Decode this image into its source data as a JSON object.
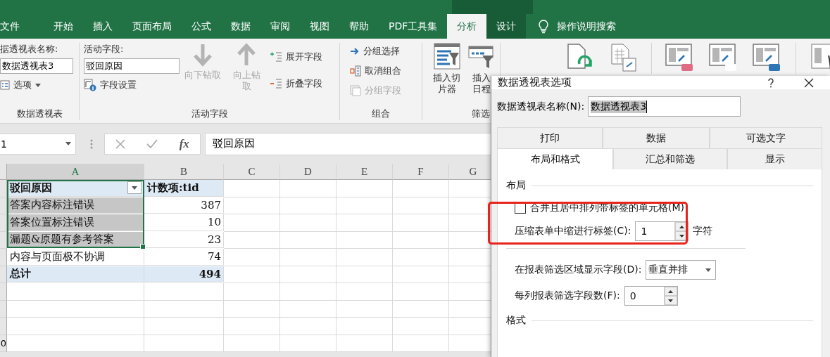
{
  "ribbon_tabs": [
    {
      "label": "文件",
      "selected": false
    },
    {
      "label": "开始",
      "selected": false
    },
    {
      "label": "插入",
      "selected": false
    },
    {
      "label": "页面布局",
      "selected": false
    },
    {
      "label": "公式",
      "selected": false
    },
    {
      "label": "数据",
      "selected": false
    },
    {
      "label": "审阅",
      "selected": false
    },
    {
      "label": "视图",
      "selected": false
    },
    {
      "label": "帮助",
      "selected": false
    },
    {
      "label": "PDF工具集",
      "selected": false
    },
    {
      "label": "分析",
      "selected": true
    },
    {
      "label": "设计",
      "selected": false
    }
  ],
  "tell_me": "操作说明搜索",
  "pivot_group": {
    "label": "数据透视表",
    "name_label": "据透视表名称:",
    "name_value": "数据透视表3",
    "options": "选项"
  },
  "active_field_group": {
    "label": "活动字段",
    "field_label": "活动字段:",
    "field_value": "驳回原因",
    "settings": "字段设置",
    "drill_down": {
      "label": "向下钻取",
      "disabled": true
    },
    "drill_up": {
      "label": "向上钻取",
      "disabled": true
    },
    "expand": "展开字段",
    "collapse": "折叠字段"
  },
  "group_group": {
    "label": "组合",
    "items": [
      {
        "label": "分组选择",
        "disabled": false
      },
      {
        "label": "取消组合",
        "disabled": false
      },
      {
        "label": "分组字段",
        "disabled": true
      }
    ]
  },
  "filter_group": {
    "label": "筛选",
    "slicer": "插入切片器",
    "timeline": "插入日程"
  },
  "formula_bar": {
    "name_box": "1",
    "fx": "fx",
    "value": "驳回原因"
  },
  "columns": [
    {
      "label": "A",
      "selected": true
    },
    {
      "label": "B",
      "selected": false
    },
    {
      "label": "C",
      "selected": false
    },
    {
      "label": "D",
      "selected": false
    },
    {
      "label": "E",
      "selected": false
    },
    {
      "label": "F",
      "selected": false
    },
    {
      "label": "G",
      "selected": false
    }
  ],
  "pivot": {
    "header": {
      "label": "驳回原因",
      "count": "计数项:tid"
    },
    "rows": [
      {
        "label": "答案内容标注错误",
        "count": "387",
        "selected": true
      },
      {
        "label": "答案位置标注错误",
        "count": "10",
        "selected": true
      },
      {
        "label": "漏题&原题有参考答案",
        "count": "23",
        "selected": true
      },
      {
        "label": "内容与页面极不协调",
        "count": "74",
        "selected": false
      }
    ],
    "total": {
      "label": "总计",
      "count": "494"
    }
  },
  "row_number_partial": "0",
  "dialog": {
    "title": "数据透视表选项",
    "name_label": "数据透视表名称(N):",
    "name_value": "数据透视表3",
    "tab_rows": [
      [
        {
          "label": "打印",
          "selected": false
        },
        {
          "label": "数据",
          "selected": false
        },
        {
          "label": "可选文字",
          "selected": false
        }
      ],
      [
        {
          "label": "布局和格式",
          "selected": true
        },
        {
          "label": "汇总和筛选",
          "selected": false
        },
        {
          "label": "显示",
          "selected": false
        }
      ]
    ],
    "layout_section": "布局",
    "merge_label": "合并且居中排列带标签的单元格(M)",
    "merge_checked": false,
    "indent_label": "压缩表单中缩进行标签(C):",
    "indent_value": "1",
    "indent_unit": "字符",
    "filter_area_label": "在报表筛选区域显示字段(D):",
    "filter_area_value": "垂直并排",
    "filter_count_label": "每列报表筛选字段数(F):",
    "filter_count_value": "0",
    "format_section": "格式"
  }
}
